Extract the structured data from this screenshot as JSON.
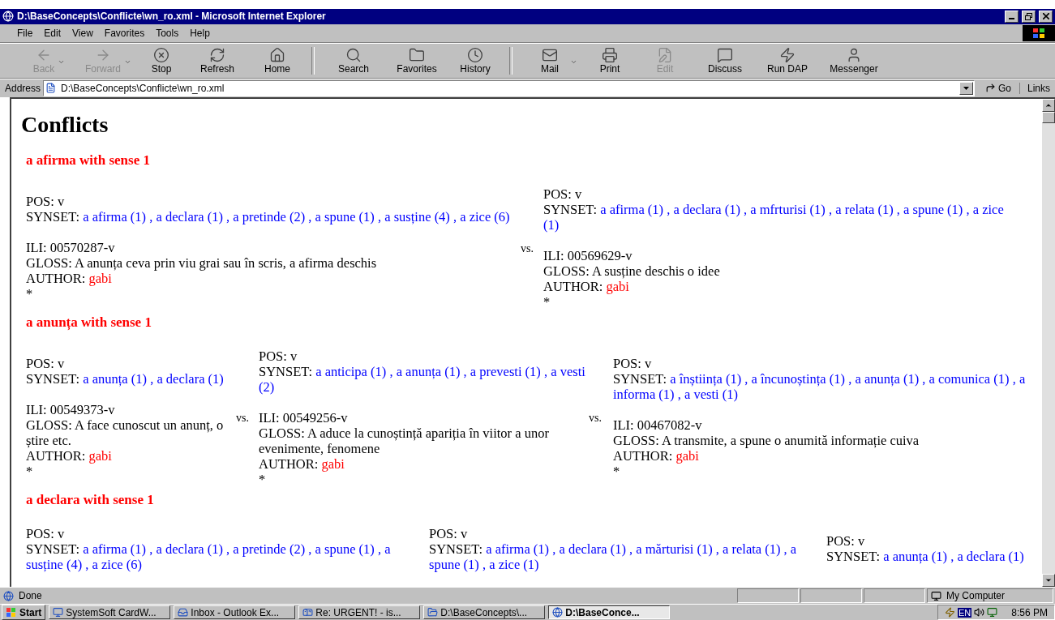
{
  "window": {
    "title": "D:\\BaseConcepts\\Conflicte\\wn_ro.xml - Microsoft Internet Explorer"
  },
  "menu": [
    "File",
    "Edit",
    "View",
    "Favorites",
    "Tools",
    "Help"
  ],
  "toolbar": [
    {
      "label": "Back",
      "disabled": true,
      "dropdown": true
    },
    {
      "label": "Forward",
      "disabled": true,
      "dropdown": true
    },
    {
      "label": "Stop",
      "disabled": false,
      "dropdown": false
    },
    {
      "label": "Refresh",
      "disabled": false,
      "dropdown": false
    },
    {
      "label": "Home",
      "disabled": false,
      "dropdown": false
    },
    {
      "label": "Search",
      "disabled": false,
      "dropdown": false
    },
    {
      "label": "Favorites",
      "disabled": false,
      "dropdown": false
    },
    {
      "label": "History",
      "disabled": false,
      "dropdown": false
    },
    {
      "label": "Mail",
      "disabled": false,
      "dropdown": true
    },
    {
      "label": "Print",
      "disabled": false,
      "dropdown": false
    },
    {
      "label": "Edit",
      "disabled": true,
      "dropdown": false
    },
    {
      "label": "Discuss",
      "disabled": false,
      "dropdown": false
    },
    {
      "label": "Run DAP",
      "disabled": false,
      "dropdown": false
    },
    {
      "label": "Messenger",
      "disabled": false,
      "dropdown": false
    }
  ],
  "address": {
    "label": "Address",
    "value": "D:\\BaseConcepts\\Conflicte\\wn_ro.xml",
    "go": "Go",
    "links": "Links"
  },
  "page": {
    "title": "Conflicts",
    "sections": [
      {
        "heading": "a afirma with sense 1",
        "entries": [
          {
            "pos_label": "POS:",
            "pos": "v",
            "synset_label": "SYNSET:",
            "synset": "a afirma (1) , a declara (1) , a pretinde (2) , a spune (1) , a susține (4) , a zice (6)",
            "ili_label": "ILI:",
            "ili": "00570287-v",
            "gloss_label": "GLOSS:",
            "gloss": "A anunța ceva prin viu grai sau în scris, a afirma deschis",
            "author_label": "AUTHOR:",
            "author": "gabi",
            "end": "*"
          },
          {
            "separator": "vs.",
            "pos_label": "POS:",
            "pos": "v",
            "synset_label": "SYNSET:",
            "synset": "a afirma (1) , a declara (1) , a mfrturisi (1) , a relata (1) , a spune (1) , a zice (1)",
            "ili_label": "ILI:",
            "ili": "00569629-v",
            "gloss_label": "GLOSS:",
            "gloss": "A susține deschis o idee",
            "author_label": "AUTHOR:",
            "author": "gabi",
            "end": "*"
          }
        ]
      },
      {
        "heading": "a anunța with sense 1",
        "entries": [
          {
            "pos_label": "POS:",
            "pos": "v",
            "synset_label": "SYNSET:",
            "synset": "a anunța (1) , a declara (1)",
            "ili_label": "ILI:",
            "ili": "00549373-v",
            "gloss_label": "GLOSS:",
            "gloss": "A face cunoscut un anunț, o știre etc.",
            "author_label": "AUTHOR:",
            "author": "gabi",
            "end": "*"
          },
          {
            "separator": "vs.",
            "pos_label": "POS:",
            "pos": "v",
            "synset_label": "SYNSET:",
            "synset": "a anticipa (1) , a anunța (1) , a prevesti (1) , a vesti (2)",
            "ili_label": "ILI:",
            "ili": "00549256-v",
            "gloss_label": "GLOSS:",
            "gloss": "A aduce la cunoștință apariția în viitor a unor evenimente, fenomene",
            "author_label": "AUTHOR:",
            "author": "gabi",
            "end": "*"
          },
          {
            "separator": "vs.",
            "pos_label": "POS:",
            "pos": "v",
            "synset_label": "SYNSET:",
            "synset": "a înștiința (1) , a încunoștința (1) , a anunța (1) , a comunica (1) , a informa (1) , a vesti (1)",
            "ili_label": "ILI:",
            "ili": "00467082-v",
            "gloss_label": "GLOSS:",
            "gloss": "A transmite, a spune o anumită informație cuiva",
            "author_label": "AUTHOR:",
            "author": "gabi",
            "end": "*"
          }
        ]
      },
      {
        "heading": "a declara with sense 1",
        "entries": [
          {
            "pos_label": "POS:",
            "pos": "v",
            "synset_label": "SYNSET:",
            "synset": "a afirma (1) , a declara (1) , a pretinde (2) , a spune (1) , a susține (4) , a zice (6)"
          },
          {
            "pos_label": "POS:",
            "pos": "v",
            "synset_label": "SYNSET:",
            "synset": "a afirma (1) , a declara (1) , a mărturisi (1) , a relata (1) , a spune (1) , a zice (1)"
          },
          {
            "pos_label": "POS:",
            "pos": "v",
            "synset_label": "SYNSET:",
            "synset": "a anunța (1) , a declara (1)"
          }
        ]
      }
    ]
  },
  "status_bar": {
    "text": "Done",
    "zone": "My Computer"
  },
  "taskbar": {
    "start": "Start",
    "tasks": [
      {
        "label": "SystemSoft CardW...",
        "selected": false
      },
      {
        "label": "Inbox - Outlook Ex...",
        "selected": false
      },
      {
        "label": "Re: URGENT! - is...",
        "selected": false
      },
      {
        "label": "D:\\BaseConcepts\\...",
        "selected": false
      },
      {
        "label": "D:\\BaseConce...",
        "selected": true
      }
    ],
    "lang": "EN",
    "time": "8:56 PM"
  }
}
